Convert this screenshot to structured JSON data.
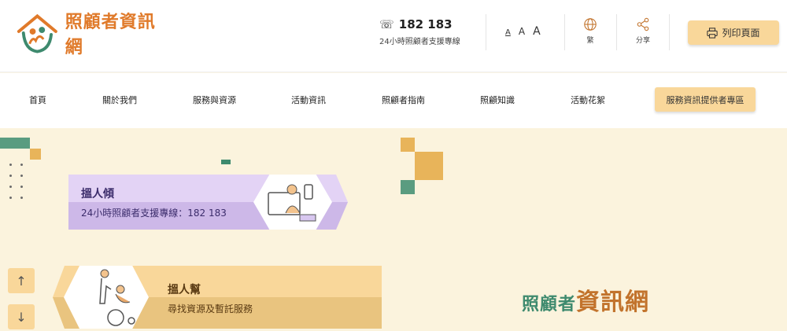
{
  "header": {
    "logo_text": "照顧者資訊網",
    "hotline_number": "182 183",
    "hotline_label": "24小時照顧者支援專線",
    "font_small": "A",
    "font_medium": "A",
    "font_large": "A",
    "lang_label": "繁",
    "share_label": "分享",
    "print_label": "列印頁面"
  },
  "nav": {
    "items": [
      "首頁",
      "關於我們",
      "服務與資源",
      "活動資訊",
      "照顧者指南",
      "照顧知識",
      "活動花絮"
    ],
    "cta_label": "服務資訊提供者專區"
  },
  "hero": {
    "card1": {
      "title": "搵人傾",
      "subtitle": "24小時照顧者支援專線：182 183"
    },
    "card2": {
      "title": "搵人幫",
      "subtitle": "尋找資源及暫託服務"
    },
    "brand_left": "照顧者",
    "brand_right": "資訊網",
    "scroll_up": "↑",
    "scroll_down": "↓"
  },
  "colors": {
    "accent": "#f9d79a",
    "green": "#3e8a6e",
    "orange": "#e07a2a",
    "purple": "#e3d3f5",
    "hero_bg": "#fbf3dd"
  }
}
